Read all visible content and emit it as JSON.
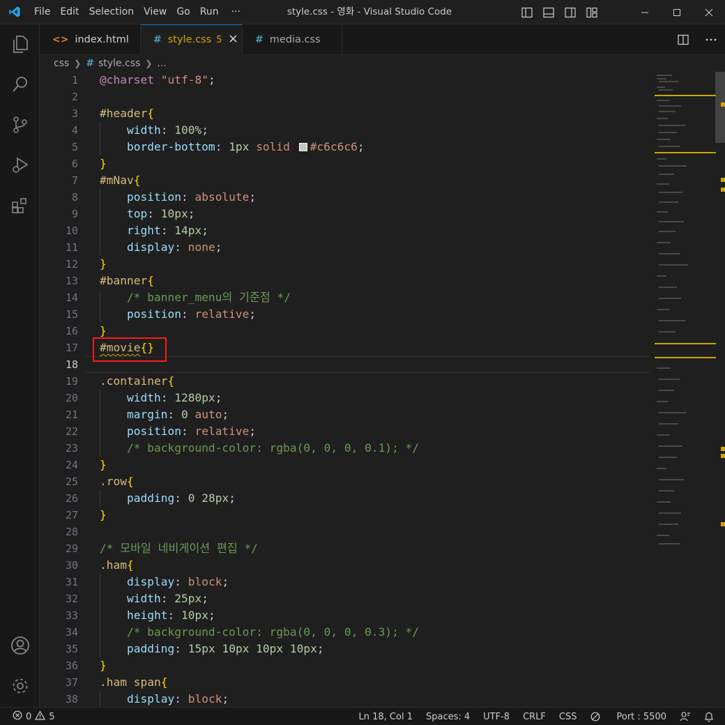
{
  "app": {
    "window_title": "style.css - 영화 - Visual Studio Code",
    "menu": [
      "File",
      "Edit",
      "Selection",
      "View",
      "Go",
      "Run",
      "···"
    ],
    "logo_icon": "vscode-logo-icon",
    "window_controls": [
      "minimize-icon",
      "maximize-icon",
      "close-icon"
    ]
  },
  "activity_bar": [
    "explorer-icon",
    "search-icon",
    "source-control-icon",
    "run-debug-icon",
    "extensions-icon",
    "account-icon",
    "settings-gear-icon"
  ],
  "tabs": [
    {
      "label": "index.html",
      "icon": "<>",
      "icon_color": "#e37933",
      "badge": "",
      "active": false
    },
    {
      "label": "style.css",
      "icon": "#",
      "icon_color": "#519aba",
      "badge": "5",
      "active": true
    },
    {
      "label": "media.css",
      "icon": "#",
      "icon_color": "#519aba",
      "badge": "",
      "active": false
    }
  ],
  "breadcrumb": {
    "folder": "css",
    "file": "style.css",
    "more": "..."
  },
  "editor": {
    "current_line": 18,
    "lines": [
      "1",
      "2",
      "3",
      "4",
      "5",
      "6",
      "7",
      "8",
      "9",
      "10",
      "11",
      "12",
      "13",
      "14",
      "15",
      "16",
      "17",
      "18",
      "19",
      "20",
      "21",
      "22",
      "23",
      "24",
      "25",
      "26",
      "27",
      "28",
      "29",
      "30",
      "31",
      "32",
      "33",
      "34",
      "35",
      "36",
      "37",
      "38"
    ],
    "code": {
      "l1_at": "@charset",
      "l1_str": "\"utf-8\"",
      "header_sel": "#header",
      "width": "width",
      "width_100": "100%",
      "border_bottom": "border-bottom",
      "one_px": "1px",
      "solid": "solid",
      "c6": "#c6c6c6",
      "mnav_sel": "#mNav",
      "position": "position",
      "absolute": "absolute",
      "top": "top",
      "ten_px": "10px",
      "right": "right",
      "fourteen_px": "14px",
      "display": "display",
      "none": "none",
      "banner_sel": "#banner",
      "banner_comment": "/* banner_menu의 기준점 */",
      "relative": "relative",
      "movie_sel": "#movie",
      "container_sel": ".container",
      "w1280": "1280px",
      "margin": "margin",
      "zero": "0",
      "auto": "auto",
      "bg_comment_1": "/* background-color: rgba(0, 0, 0, 0.1); */",
      "row_sel": ".row",
      "padding": "padding",
      "twentyeight": "28px",
      "mobile_comment": "/* 모바일 네비게이션 편집 */",
      "ham_sel": ".ham",
      "block": "block",
      "w25": "25px",
      "height": "height",
      "bg_comment_2": "/* background-color: rgba(0, 0, 0, 0.3); */",
      "pad_vals": "15px 10px 10px 10px",
      "ham_span_sel": ".ham span"
    }
  },
  "statusbar": {
    "errors": "0",
    "warnings": "5",
    "position": "Ln 18, Col 1",
    "spaces": "Spaces: 4",
    "encoding": "UTF-8",
    "eol": "CRLF",
    "language": "CSS",
    "port": "Port : 5500"
  },
  "colors": {
    "accent": "#0078d4",
    "warning": "#cca700",
    "highlight_box": "#ff1a1a"
  }
}
